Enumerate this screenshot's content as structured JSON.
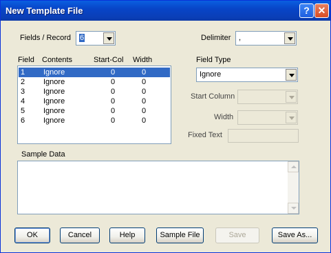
{
  "window": {
    "title": "New Template File",
    "help_glyph": "?",
    "close_glyph": "✕"
  },
  "fields_per_record": {
    "label": "Fields / Record",
    "value": "6"
  },
  "delimiter": {
    "label": "Delimiter",
    "value": ","
  },
  "field_table": {
    "headers": [
      "Field",
      "Contents",
      "Start-Col",
      "Width"
    ],
    "rows": [
      {
        "field": "1",
        "contents": "Ignore",
        "start_col": "0",
        "width": "0",
        "selected": true
      },
      {
        "field": "2",
        "contents": "Ignore",
        "start_col": "0",
        "width": "0"
      },
      {
        "field": "3",
        "contents": "Ignore",
        "start_col": "0",
        "width": "0"
      },
      {
        "field": "4",
        "contents": "Ignore",
        "start_col": "0",
        "width": "0"
      },
      {
        "field": "5",
        "contents": "Ignore",
        "start_col": "0",
        "width": "0"
      },
      {
        "field": "6",
        "contents": "Ignore",
        "start_col": "0",
        "width": "0"
      }
    ]
  },
  "field_type": {
    "label": "Field Type",
    "value": "Ignore"
  },
  "start_column": {
    "label": "Start Column",
    "value": ""
  },
  "width": {
    "label": "Width",
    "value": ""
  },
  "fixed_text": {
    "label": "Fixed Text",
    "value": ""
  },
  "sample_data": {
    "label": "Sample Data",
    "value": ""
  },
  "buttons": {
    "ok": "OK",
    "cancel": "Cancel",
    "help": "Help",
    "sample_file": "Sample File",
    "save": "Save",
    "save_as": "Save As..."
  }
}
